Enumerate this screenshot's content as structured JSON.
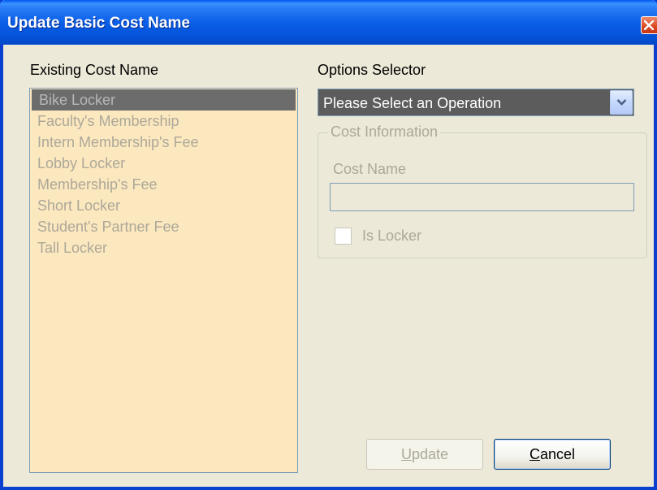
{
  "window": {
    "title": "Update Basic Cost Name"
  },
  "left_panel": {
    "heading": "Existing Cost Name",
    "items": [
      "Bike Locker",
      "Faculty's Membership",
      "Intern Membership's Fee",
      "Lobby Locker",
      "Membership's Fee",
      "Short Locker",
      "Student's Partner Fee",
      "Tall Locker"
    ],
    "selected_item": "Bike Locker"
  },
  "right_panel": {
    "options_heading": "Options Selector",
    "options_value": "Please Select an Operation",
    "group_title": "Cost Information",
    "cost_name_label": "Cost Name",
    "cost_name_value": "",
    "is_locker_label": "Is Locker",
    "is_locker_checked": false
  },
  "buttons": {
    "update_first": "U",
    "update_rest": "pdate",
    "cancel_first": "C",
    "cancel_rest": "ancel"
  },
  "icons": {
    "close": "close-icon",
    "dropdown": "chevron-down-icon"
  },
  "colors": {
    "titlebar": "#0A5FE8",
    "window_bg": "#ECE9D8",
    "listbox_bg": "#FCE8BF",
    "close_button": "#D9481E"
  }
}
